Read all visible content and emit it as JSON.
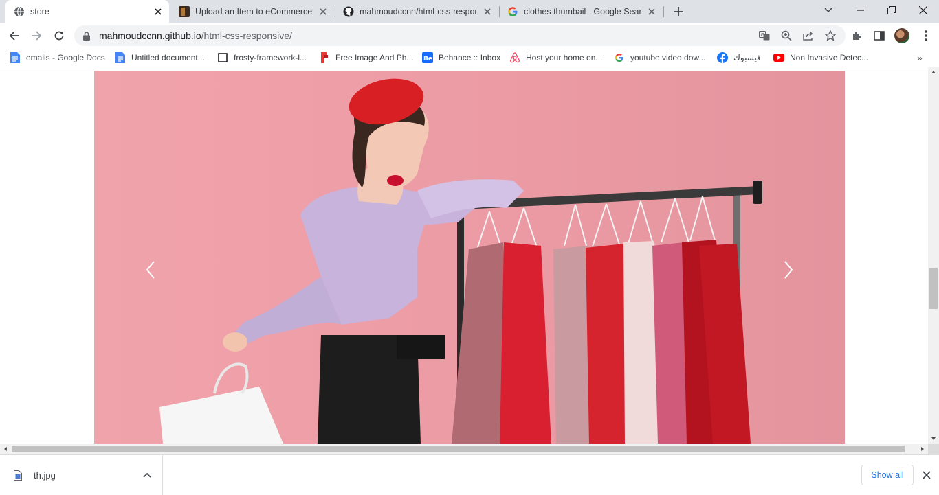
{
  "tabs": [
    {
      "title": "store",
      "favicon": "globe-icon",
      "active": true
    },
    {
      "title": "Upload an Item to eCommerce |",
      "favicon": "envato-icon",
      "active": false
    },
    {
      "title": "mahmoudccnn/html-css-respons",
      "favicon": "github-icon",
      "active": false
    },
    {
      "title": "clothes thumbail - Google Search",
      "favicon": "google-icon",
      "active": false
    }
  ],
  "address_bar": {
    "host": "mahmoudccnn.github.io",
    "path": "/html-css-responsive/"
  },
  "bookmarks": [
    {
      "label": "emails - Google Docs",
      "icon": "google-docs-icon"
    },
    {
      "label": "Untitled document...",
      "icon": "google-docs-icon"
    },
    {
      "label": "frosty-framework-l...",
      "icon": "page-icon"
    },
    {
      "label": "Free Image And Ph...",
      "icon": "freepik-icon"
    },
    {
      "label": "Behance :: Inbox",
      "icon": "behance-icon"
    },
    {
      "label": "Host your home on...",
      "icon": "airbnb-icon"
    },
    {
      "label": "youtube video dow...",
      "icon": "google-icon"
    },
    {
      "label": "فيسبوك",
      "icon": "facebook-icon"
    },
    {
      "label": "Non Invasive Detec...",
      "icon": "youtube-icon"
    }
  ],
  "carousel": {
    "image": "woman-clothes-rack-photo",
    "prev": "chevron-left-icon",
    "next": "chevron-right-icon"
  },
  "downloads": {
    "file_name": "th.jpg",
    "show_all": "Show all"
  },
  "colors": {
    "tabstrip": "#dee1e6",
    "hero_pink": "#ec9da5",
    "link_blue": "#1a73e8"
  }
}
